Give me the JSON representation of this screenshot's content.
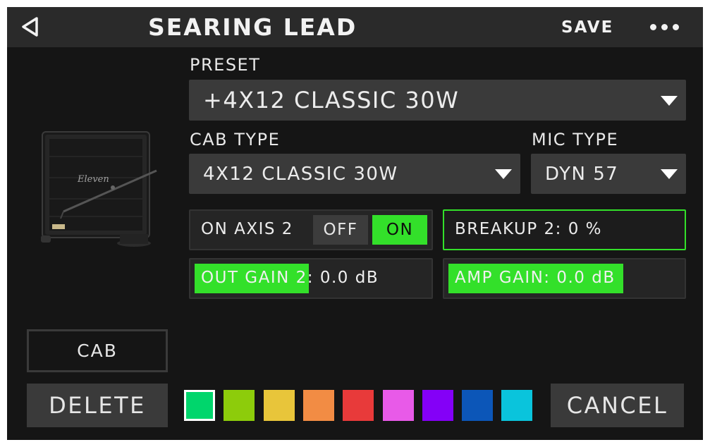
{
  "header": {
    "title": "SEARING LEAD",
    "save_label": "SAVE",
    "back_icon": "back-triangle-icon",
    "more_icon": "more-dots-icon"
  },
  "preset": {
    "label": "PRESET",
    "value": "+4X12 CLASSIC 30W"
  },
  "cab_type": {
    "label": "CAB TYPE",
    "value": "4X12 CLASSIC 30W"
  },
  "mic_type": {
    "label": "MIC TYPE",
    "value": "DYN 57"
  },
  "on_axis": {
    "label": "ON AXIS 2",
    "off_label": "OFF",
    "on_label": "ON",
    "selected": "ON"
  },
  "breakup": {
    "text": "BREAKUP 2: 0 %",
    "level_percent": 0
  },
  "out_gain": {
    "text": "OUT GAIN 2: 0.0 dB",
    "level_fraction": 0.49
  },
  "amp_gain": {
    "text": "AMP GAIN: 0.0 dB",
    "level_fraction": 0.75
  },
  "cab_image": {
    "brand": "Eleven"
  },
  "footer": {
    "cab_label": "CAB",
    "delete_label": "DELETE",
    "cancel_label": "CANCEL"
  },
  "colors": {
    "accent_green": "#33e02a",
    "swatches": [
      "#00d66c",
      "#8dcc0b",
      "#e8c53a",
      "#f28c44",
      "#e83a3a",
      "#e85ae8",
      "#8400f7",
      "#0c56b8",
      "#0ac4dc"
    ],
    "selected_swatch_index": 0
  }
}
